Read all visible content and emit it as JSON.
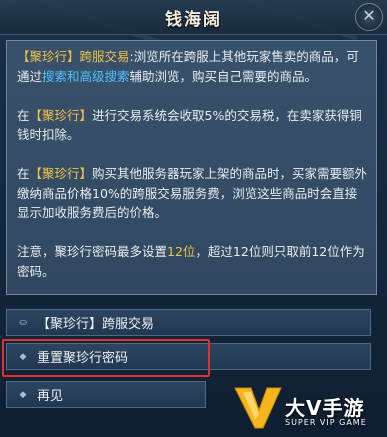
{
  "dialog": {
    "title": "钱海阔",
    "close_glyph": "✕"
  },
  "content": {
    "p1_tag": "【聚珍行】跨服交易",
    "p1_a": ":浏览所在跨服上其他玩家售卖的商品，可通过",
    "p1_link": "搜索和高级搜索",
    "p1_b": "辅助浏览，购买自己需要的商品。",
    "p2_a": "在",
    "p2_tag": "【聚珍行】",
    "p2_b": "进行交易系统会收取5%的交易税，在卖家获得铜钱时扣除。",
    "p3_a": "在",
    "p3_tag": "【聚珍行】",
    "p3_b": "购买其他服务器玩家上架的商品时，买家需要额外缴纳商品价格10%的跨服交易服务费，浏览这些商品时会直接显示加收服务费后的价格。",
    "p4_a": "注意，聚珍行密码最多设置",
    "p4_num": "12位",
    "p4_b": "，超过12位则只取前12位作为密码。"
  },
  "options": [
    {
      "label": "【聚珍行】跨服交易",
      "icon": "coins-icon",
      "glyph": "⛀"
    },
    {
      "label": "重置聚珍行密码",
      "icon": "diamond-icon",
      "glyph": "◆"
    },
    {
      "label": "再见",
      "icon": "diamond-icon",
      "glyph": "◆"
    }
  ],
  "watermark": {
    "brand": "大V手游",
    "sub": "SUPER VIP GAME"
  },
  "colors": {
    "highlight_yellow": "#f0c24a",
    "highlight_blue": "#4fc3ff",
    "annotation_red": "#e03030"
  }
}
